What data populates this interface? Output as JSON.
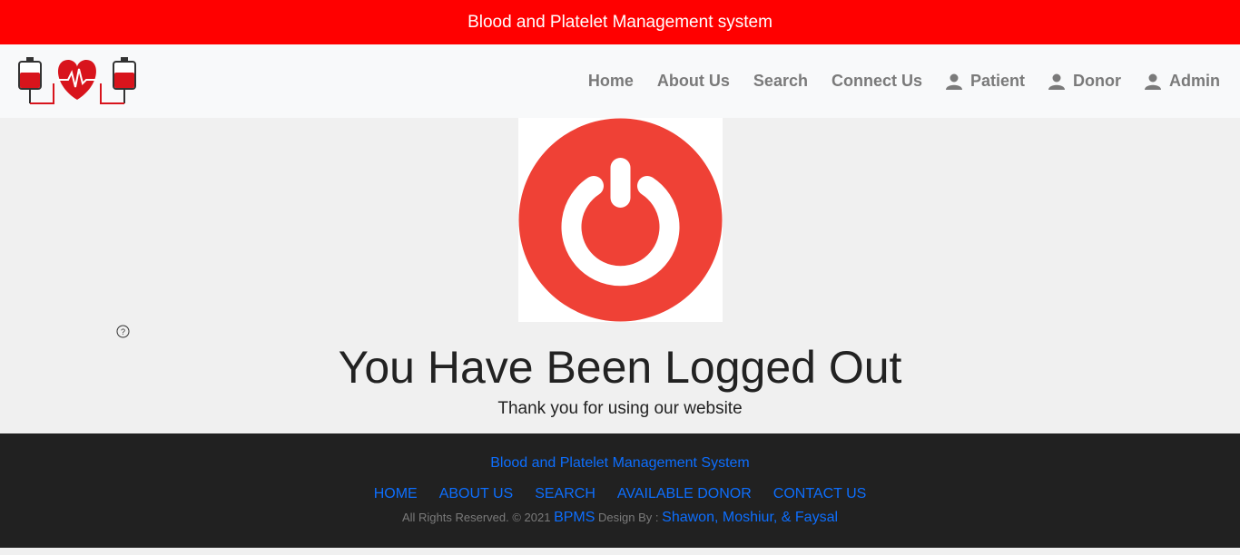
{
  "topbar": {
    "title": "Blood and Platelet Management system"
  },
  "header": {
    "logo_icon": "blood-bag-heartbeat-logo",
    "nav": [
      {
        "label": "Home"
      },
      {
        "label": "About Us"
      },
      {
        "label": "Search"
      },
      {
        "label": "Connect Us"
      },
      {
        "label": "Patient",
        "icon": "user-icon"
      },
      {
        "label": "Donor",
        "icon": "user-icon"
      },
      {
        "label": "Admin",
        "icon": "user-icon"
      }
    ]
  },
  "main": {
    "power_icon": "power-icon",
    "heading": "You Have Been Logged Out",
    "subheading": "Thank you for using our website"
  },
  "footer": {
    "title": "Blood and Platelet Management System",
    "links": [
      {
        "label": "HOME"
      },
      {
        "label": "ABOUT US"
      },
      {
        "label": "SEARCH"
      },
      {
        "label": "AVAILABLE DONOR"
      },
      {
        "label": "CONTACT US"
      }
    ],
    "copyright": "All Rights Reserved. © 2021",
    "brand": "BPMS",
    "design_by": "Design By :",
    "authors": "Shawon, Moshiur, & Faysal"
  },
  "colors": {
    "topbar": "#ff0000",
    "power_red": "#ef4136",
    "link_blue": "#0d6efd",
    "footer_bg": "#212121",
    "nav_text": "#7a7a7a"
  }
}
